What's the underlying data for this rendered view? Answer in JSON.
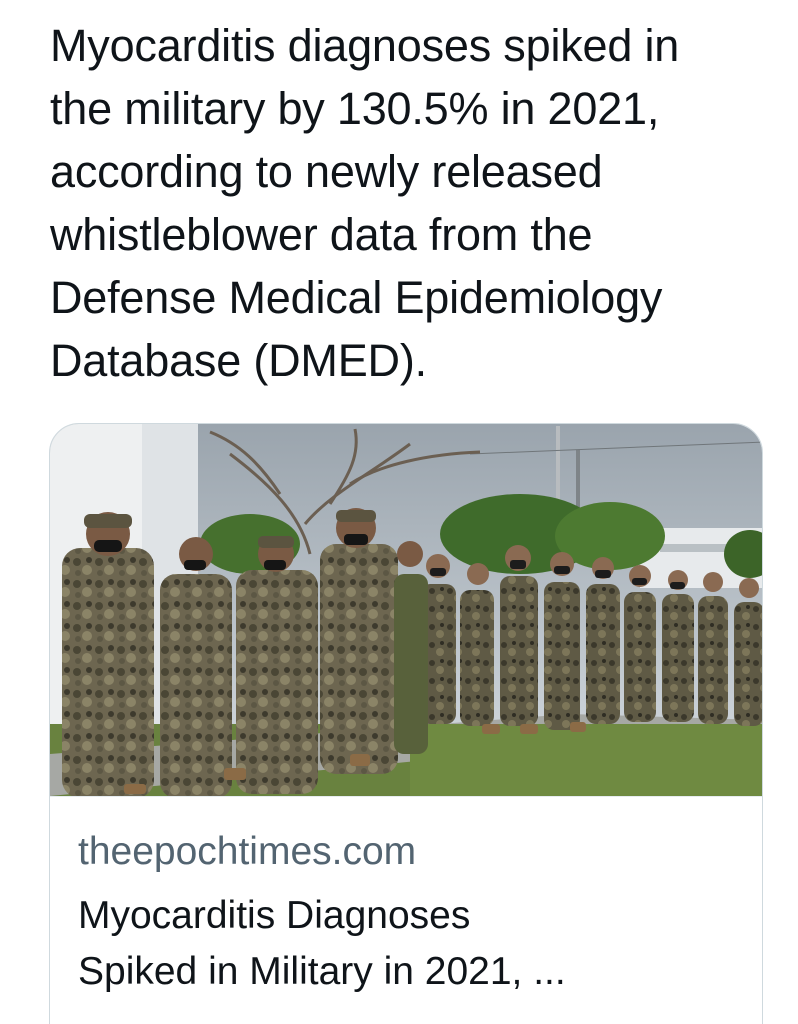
{
  "tweet": {
    "text": "Myocarditis diagnoses spiked in\nthe military by 130.5% in 2021,\naccording to newly released\nwhistleblower data from the\nDefense Medical Epidemiology\nDatabase (DMED)."
  },
  "link_card": {
    "domain": "theepochtimes.com",
    "title_line1": "Myocarditis Diagnoses",
    "title_line2": "Spiked in Military in 2021, ..."
  }
}
